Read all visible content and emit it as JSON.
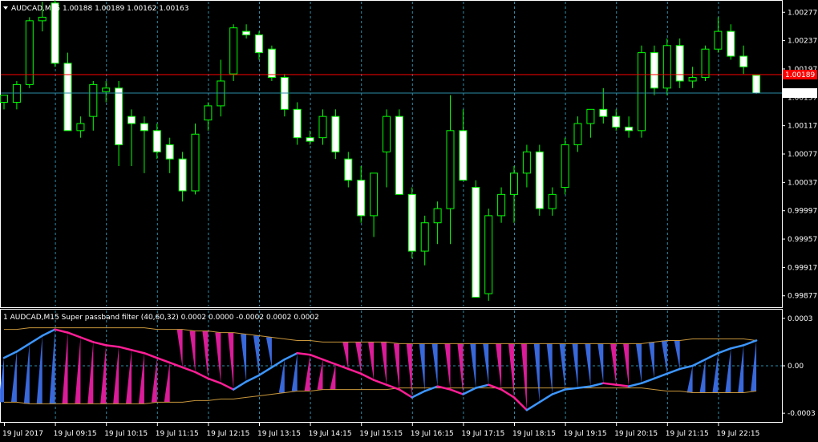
{
  "colors": {
    "background": "#000000",
    "axis": "#ffffff",
    "grid": "#2d8ca8",
    "bull_fill": "#000000",
    "bear_fill": "#ffffff",
    "wick": "#00ff00",
    "bid_line": "#ff0000",
    "ask_line": "#2d8ca8",
    "bid_label_bg": "#ff0000",
    "filter_pink": "#ff1e96",
    "filter_blue": "#3c96ff",
    "hist_pink": "#e61ea0",
    "hist_blue": "#3c6ee6",
    "band": "#c8963c",
    "zero_line": "#2d8ca8"
  },
  "main_title": "AUDCAD,M15  1.00188 1.00189 1.00162 1.00163",
  "indicator_title": "1 AUDCAD,M15 Super passband filter (40,60,32) 0.0002 0.0000 -0.0002 0.0002 0.0002",
  "price_labels": [
    "1.00277",
    "1.00237",
    "1.00197",
    "1.00157",
    "1.00117",
    "1.00077",
    "1.00037",
    "0.99997",
    "0.99957",
    "0.99917",
    "0.99877"
  ],
  "bid_label": "1.00189",
  "ask_label": "1.00163",
  "indicator_labels": [
    "0.0003",
    "0.00",
    "-0.0003"
  ],
  "time_labels": [
    "19 Jul 2017",
    "19 Jul 09:15",
    "19 Jul 10:15",
    "19 Jul 11:15",
    "19 Jul 12:15",
    "19 Jul 13:15",
    "19 Jul 14:15",
    "19 Jul 15:15",
    "19 Jul 16:15",
    "19 Jul 17:15",
    "19 Jul 18:15",
    "19 Jul 19:15",
    "19 Jul 20:15",
    "19 Jul 21:15",
    "19 Jul 22:15"
  ],
  "chart_data": {
    "type": "candlestick",
    "symbol": "AUDCAD",
    "timeframe": "M15",
    "title": "AUDCAD,M15  1.00188 1.00189 1.00162 1.00163",
    "price_range": [
      0.99862,
      1.00292
    ],
    "bid": 1.00189,
    "ask": 1.00163,
    "time_labels": [
      "19 Jul 2017",
      "19 Jul 09:15",
      "19 Jul 10:15",
      "19 Jul 11:15",
      "19 Jul 12:15",
      "19 Jul 13:15",
      "19 Jul 14:15",
      "19 Jul 15:15",
      "19 Jul 16:15",
      "19 Jul 17:15",
      "19 Jul 18:15",
      "19 Jul 19:15",
      "19 Jul 20:15",
      "19 Jul 21:15",
      "19 Jul 22:15"
    ],
    "candles": [
      [
        1.0015,
        1.0016,
        1.0014,
        1.0016
      ],
      [
        1.0015,
        1.0018,
        1.0014,
        1.00175
      ],
      [
        1.00175,
        1.0027,
        1.0017,
        1.00265
      ],
      [
        1.00265,
        1.00292,
        1.0025,
        1.0027
      ],
      [
        1.0029,
        1.003,
        1.002,
        1.00205
      ],
      [
        1.00205,
        1.0022,
        1.0012,
        1.0011
      ],
      [
        1.0011,
        1.0013,
        1.001,
        1.0012
      ],
      [
        1.0013,
        1.0018,
        1.0011,
        1.00175
      ],
      [
        1.00165,
        1.0018,
        1.0015,
        1.0017
      ],
      [
        1.0017,
        1.0018,
        1.0006,
        1.0009
      ],
      [
        1.0013,
        1.0014,
        1.0006,
        1.0012
      ],
      [
        1.0012,
        1.0013,
        1.0005,
        1.0011
      ],
      [
        1.0011,
        1.0012,
        1.0007,
        1.0008
      ],
      [
        1.0009,
        1.001,
        1.0005,
        1.0007
      ],
      [
        1.0007,
        1.0008,
        1.0001,
        1.00025
      ],
      [
        1.00025,
        1.0012,
        1.0002,
        1.00105
      ],
      [
        1.00125,
        1.0015,
        1.0011,
        1.00145
      ],
      [
        1.00145,
        1.0021,
        1.0013,
        1.0018
      ],
      [
        1.0019,
        1.0026,
        1.0018,
        1.00255
      ],
      [
        1.0025,
        1.0026,
        1.0024,
        1.00245
      ],
      [
        1.00245,
        1.0025,
        1.0021,
        1.0022
      ],
      [
        1.00225,
        1.0023,
        1.0018,
        1.00185
      ],
      [
        1.00185,
        1.0019,
        1.0013,
        1.0014
      ],
      [
        1.0014,
        1.0015,
        1.0009,
        1.001
      ],
      [
        1.001,
        1.0011,
        1.0009,
        1.00095
      ],
      [
        1.001,
        1.0014,
        1.0009,
        1.0013
      ],
      [
        1.0013,
        1.0014,
        1.0007,
        1.0008
      ],
      [
        1.0007,
        1.0008,
        1.0003,
        1.0004
      ],
      [
        1.0004,
        1.0006,
        0.9998,
        0.9999
      ],
      [
        0.9999,
        1.0005,
        0.9996,
        1.0005
      ],
      [
        1.0008,
        1.0014,
        1.0003,
        1.0013
      ],
      [
        1.0013,
        1.0014,
        1.0002,
        1.0002
      ],
      [
        1.0002,
        1.0003,
        0.9993,
        0.9994
      ],
      [
        0.9994,
        0.9999,
        0.9992,
        0.9998
      ],
      [
        0.9998,
        1.0001,
        0.9995,
        1.0
      ],
      [
        1.0,
        1.0016,
        0.9995,
        1.0011
      ],
      [
        1.0011,
        1.0014,
        1.0004,
        1.0004
      ],
      [
        1.0003,
        1.0004,
        0.99875,
        0.99875
      ],
      [
        0.9988,
        1.0,
        0.9987,
        0.9999
      ],
      [
        0.9999,
        1.0003,
        0.9998,
        1.0002
      ],
      [
        1.0002,
        1.0006,
        0.9998,
        1.0005
      ],
      [
        1.0005,
        1.0009,
        1.0003,
        1.0008
      ],
      [
        1.0008,
        1.0009,
        0.9999,
        1.0
      ],
      [
        1.0,
        1.0003,
        0.9999,
        1.0002
      ],
      [
        1.0003,
        1.001,
        1.0002,
        1.0009
      ],
      [
        1.0009,
        1.0013,
        1.0008,
        1.0012
      ],
      [
        1.0012,
        1.0014,
        1.001,
        1.0014
      ],
      [
        1.0014,
        1.0017,
        1.0012,
        1.0013
      ],
      [
        1.0013,
        1.0014,
        1.0011,
        1.00115
      ],
      [
        1.00115,
        1.0013,
        1.001,
        1.0011
      ],
      [
        1.0011,
        1.0023,
        1.001,
        1.0022
      ],
      [
        1.0022,
        1.0023,
        1.0016,
        1.0017
      ],
      [
        1.0017,
        1.0024,
        1.0016,
        1.0023
      ],
      [
        1.0023,
        1.0024,
        1.0017,
        1.0018
      ],
      [
        1.0018,
        1.002,
        1.0017,
        1.00185
      ],
      [
        1.00185,
        1.0023,
        1.0018,
        1.00225
      ],
      [
        1.00225,
        1.0027,
        1.0022,
        1.0025
      ],
      [
        1.0025,
        1.0026,
        1.0021,
        1.00215
      ],
      [
        1.00215,
        1.0023,
        1.0019,
        1.002
      ],
      [
        1.00188,
        1.00189,
        1.00162,
        1.00163
      ]
    ],
    "indicator": {
      "name": "Super passband filter",
      "params": [
        40,
        60,
        32
      ],
      "range": [
        -0.00035,
        0.00035
      ],
      "filter": [
        5e-05,
        9e-05,
        0.00014,
        0.00019,
        0.00023,
        0.00021,
        0.00018,
        0.00015,
        0.00013,
        0.00012,
        0.0001,
        8e-05,
        5e-05,
        2e-05,
        -1e-05,
        -4e-05,
        -8e-05,
        -0.00011,
        -0.00015,
        -0.0001,
        -6e-05,
        -1e-05,
        4e-05,
        8e-05,
        7e-05,
        4e-05,
        1e-05,
        -2e-05,
        -5e-05,
        -9e-05,
        -0.00012,
        -0.00015,
        -0.0002,
        -0.00016,
        -0.00013,
        -0.00015,
        -0.00018,
        -0.00014,
        -0.00012,
        -0.00015,
        -0.0002,
        -0.00028,
        -0.00023,
        -0.00018,
        -0.00015,
        -0.00014,
        -0.00013,
        -0.00011,
        -0.00012,
        -0.00013,
        -0.00011,
        -8e-05,
        -5e-05,
        -2e-05,
        0.0,
        4e-05,
        8e-05,
        0.00011,
        0.00013,
        0.00016
      ],
      "upper_band": [
        0.00023,
        0.00023,
        0.00024,
        0.00024,
        0.00024,
        0.00024,
        0.00024,
        0.00024,
        0.00024,
        0.00024,
        0.00024,
        0.00024,
        0.00023,
        0.00023,
        0.00023,
        0.00022,
        0.00022,
        0.00021,
        0.00021,
        0.0002,
        0.00019,
        0.00018,
        0.00017,
        0.00016,
        0.00016,
        0.00015,
        0.00015,
        0.00015,
        0.00015,
        0.00015,
        0.00015,
        0.00014,
        0.00014,
        0.00014,
        0.00014,
        0.00014,
        0.00014,
        0.00014,
        0.00014,
        0.00014,
        0.00014,
        0.00014,
        0.00014,
        0.00014,
        0.00014,
        0.00014,
        0.00014,
        0.00014,
        0.00014,
        0.00014,
        0.00014,
        0.00015,
        0.00016,
        0.00016,
        0.00017,
        0.00017,
        0.00017,
        0.00017,
        0.00017,
        0.00016
      ],
      "lower_band": [
        -0.00023,
        -0.00023,
        -0.00024,
        -0.00024,
        -0.00024,
        -0.00024,
        -0.00024,
        -0.00024,
        -0.00024,
        -0.00024,
        -0.00024,
        -0.00024,
        -0.00023,
        -0.00023,
        -0.00023,
        -0.00022,
        -0.00022,
        -0.00021,
        -0.00021,
        -0.0002,
        -0.00019,
        -0.00018,
        -0.00017,
        -0.00016,
        -0.00016,
        -0.00015,
        -0.00015,
        -0.00015,
        -0.00015,
        -0.00015,
        -0.00015,
        -0.00014,
        -0.00014,
        -0.00014,
        -0.00014,
        -0.00014,
        -0.00014,
        -0.00014,
        -0.00014,
        -0.00014,
        -0.00014,
        -0.00014,
        -0.00014,
        -0.00014,
        -0.00014,
        -0.00014,
        -0.00014,
        -0.00014,
        -0.00014,
        -0.00014,
        -0.00014,
        -0.00015,
        -0.00016,
        -0.00016,
        -0.00017,
        -0.00017,
        -0.00017,
        -0.00017,
        -0.00017,
        -0.00016
      ]
    }
  }
}
